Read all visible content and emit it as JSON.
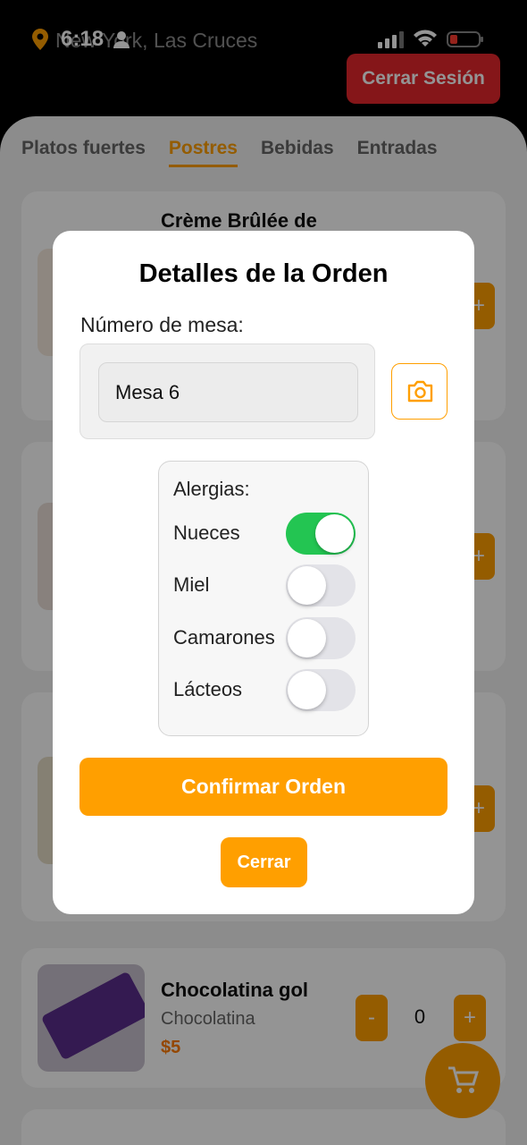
{
  "status_bar": {
    "time": "6:18",
    "location": "New York, Las Cruces",
    "icons": [
      "location-pin-icon",
      "person-icon",
      "signal-icon",
      "wifi-icon",
      "battery-icon"
    ]
  },
  "header": {
    "logout_label": "Cerrar Sesión"
  },
  "tabs": [
    {
      "label": "Platos fuertes",
      "active": false
    },
    {
      "label": "Postres",
      "active": true
    },
    {
      "label": "Bebidas",
      "active": false
    },
    {
      "label": "Entradas",
      "active": false
    }
  ],
  "products": [
    {
      "title": "Crème Brûlée de",
      "subtitle": "",
      "price": "",
      "quantity": ""
    },
    {
      "title": "Chocolatina gol",
      "subtitle": "Chocolatina",
      "price": "$5",
      "quantity": "0",
      "minus_label": "-",
      "plus_label": "+"
    }
  ],
  "modal": {
    "title": "Detalles de la Orden",
    "table_label": "Número de mesa:",
    "table_value": "Mesa 6",
    "allergies_title": "Alergias:",
    "allergies": [
      {
        "name": "Nueces",
        "enabled": true
      },
      {
        "name": "Miel",
        "enabled": false
      },
      {
        "name": "Camarones",
        "enabled": false
      },
      {
        "name": "Lácteos",
        "enabled": false
      }
    ],
    "confirm_label": "Confirmar Orden",
    "close_label": "Cerrar"
  },
  "colors": {
    "accent": "#ff9f00",
    "logout": "#e5262c",
    "toggle_on": "#23c552",
    "price": "#ff7a00"
  }
}
